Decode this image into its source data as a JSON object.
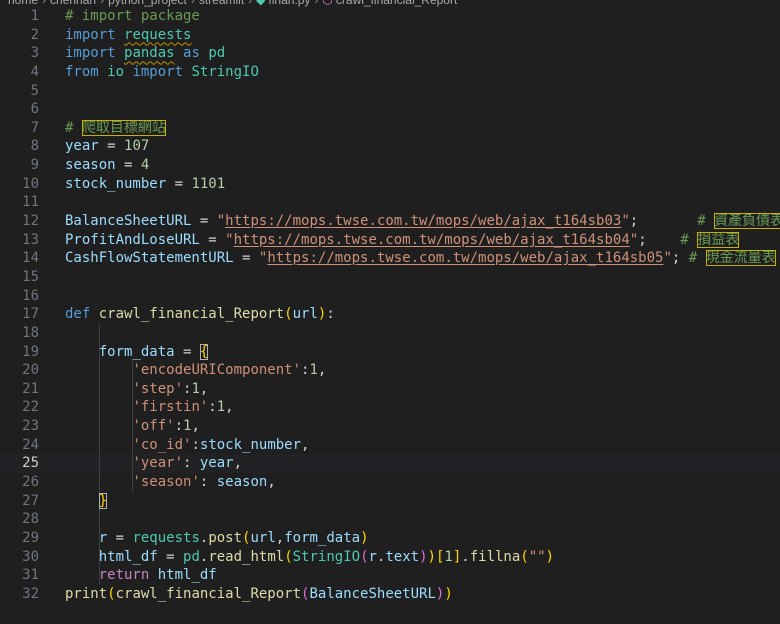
{
  "breadcrumb": {
    "segments": [
      "home",
      "chenhan",
      "python_project",
      "streamlit",
      "finan.py",
      "crawl_financial_Report"
    ]
  },
  "editor": {
    "active_line": 25,
    "lines": [
      {
        "n": 1,
        "tokens": [
          [
            "cmt",
            "# import package"
          ]
        ]
      },
      {
        "n": 2,
        "tokens": [
          [
            "kw",
            "import"
          ],
          [
            "plain",
            " "
          ],
          [
            "cls squig",
            "requests"
          ]
        ]
      },
      {
        "n": 3,
        "tokens": [
          [
            "kw",
            "import"
          ],
          [
            "plain",
            " "
          ],
          [
            "cls squig",
            "pandas"
          ],
          [
            "plain",
            " "
          ],
          [
            "kw",
            "as"
          ],
          [
            "plain",
            " "
          ],
          [
            "cls",
            "pd"
          ]
        ]
      },
      {
        "n": 4,
        "tokens": [
          [
            "kw",
            "from"
          ],
          [
            "plain",
            " "
          ],
          [
            "cls",
            "io"
          ],
          [
            "plain",
            " "
          ],
          [
            "kw",
            "import"
          ],
          [
            "plain",
            " "
          ],
          [
            "cls",
            "StringIO"
          ]
        ]
      },
      {
        "n": 5,
        "tokens": []
      },
      {
        "n": 6,
        "tokens": []
      },
      {
        "n": 7,
        "tokens": [
          [
            "cmt",
            "# "
          ],
          [
            "cmt hl-box",
            "爬取目標網站"
          ]
        ]
      },
      {
        "n": 8,
        "tokens": [
          [
            "var",
            "year"
          ],
          [
            "plain",
            " = "
          ],
          [
            "num",
            "107"
          ]
        ]
      },
      {
        "n": 9,
        "tokens": [
          [
            "var",
            "season"
          ],
          [
            "plain",
            " = "
          ],
          [
            "num",
            "4"
          ]
        ]
      },
      {
        "n": 10,
        "tokens": [
          [
            "var",
            "stock_number"
          ],
          [
            "plain",
            " = "
          ],
          [
            "num",
            "1101"
          ]
        ]
      },
      {
        "n": 11,
        "tokens": []
      },
      {
        "n": 12,
        "tokens": [
          [
            "var",
            "BalanceSheetURL"
          ],
          [
            "plain",
            " = "
          ],
          [
            "str",
            "\""
          ],
          [
            "str url",
            "https://mops.twse.com.tw/mops/web/ajax_t164sb03"
          ],
          [
            "str",
            "\""
          ],
          [
            "plain",
            ";       "
          ],
          [
            "cmt",
            "# "
          ],
          [
            "cmt hl-box",
            "資產負債表"
          ]
        ]
      },
      {
        "n": 13,
        "tokens": [
          [
            "var",
            "ProfitAndLoseURL"
          ],
          [
            "plain",
            " = "
          ],
          [
            "str",
            "\""
          ],
          [
            "str url",
            "https://mops.twse.com.tw/mops/web/ajax_t164sb04"
          ],
          [
            "str",
            "\""
          ],
          [
            "plain",
            ";    "
          ],
          [
            "cmt",
            "# "
          ],
          [
            "cmt hl-box",
            "損益表"
          ]
        ]
      },
      {
        "n": 14,
        "tokens": [
          [
            "var",
            "CashFlowStatementURL"
          ],
          [
            "plain",
            " = "
          ],
          [
            "str",
            "\""
          ],
          [
            "str url",
            "https://mops.twse.com.tw/mops/web/ajax_t164sb05"
          ],
          [
            "str",
            "\""
          ],
          [
            "plain",
            "; "
          ],
          [
            "cmt",
            "# "
          ],
          [
            "cmt hl-box",
            "現金流量表"
          ]
        ]
      },
      {
        "n": 15,
        "tokens": []
      },
      {
        "n": 16,
        "tokens": []
      },
      {
        "n": 17,
        "tokens": [
          [
            "kw",
            "def"
          ],
          [
            "plain",
            " "
          ],
          [
            "fn",
            "crawl_financial_Report"
          ],
          [
            "br1",
            "("
          ],
          [
            "var",
            "url"
          ],
          [
            "br1",
            ")"
          ],
          [
            "plain",
            ":"
          ]
        ]
      },
      {
        "n": 18,
        "tokens": []
      },
      {
        "n": 19,
        "tokens": [
          [
            "plain",
            "    "
          ],
          [
            "var",
            "form_data"
          ],
          [
            "plain",
            " = "
          ],
          [
            "br1 brace-box",
            "{"
          ]
        ]
      },
      {
        "n": 20,
        "tokens": [
          [
            "plain",
            "        "
          ],
          [
            "str",
            "'encodeURIComponent'"
          ],
          [
            "plain",
            ":"
          ],
          [
            "num",
            "1"
          ],
          [
            "plain",
            ","
          ]
        ]
      },
      {
        "n": 21,
        "tokens": [
          [
            "plain",
            "        "
          ],
          [
            "str",
            "'step'"
          ],
          [
            "plain",
            ":"
          ],
          [
            "num",
            "1"
          ],
          [
            "plain",
            ","
          ]
        ]
      },
      {
        "n": 22,
        "tokens": [
          [
            "plain",
            "        "
          ],
          [
            "str",
            "'firstin'"
          ],
          [
            "plain",
            ":"
          ],
          [
            "num",
            "1"
          ],
          [
            "plain",
            ","
          ]
        ]
      },
      {
        "n": 23,
        "tokens": [
          [
            "plain",
            "        "
          ],
          [
            "str",
            "'off'"
          ],
          [
            "plain",
            ":"
          ],
          [
            "num",
            "1"
          ],
          [
            "plain",
            ","
          ]
        ]
      },
      {
        "n": 24,
        "tokens": [
          [
            "plain",
            "        "
          ],
          [
            "str",
            "'co_id'"
          ],
          [
            "plain",
            ":"
          ],
          [
            "var",
            "stock_number"
          ],
          [
            "plain",
            ","
          ]
        ]
      },
      {
        "n": 25,
        "tokens": [
          [
            "plain",
            "        "
          ],
          [
            "str",
            "'year'"
          ],
          [
            "plain",
            ": "
          ],
          [
            "var",
            "year"
          ],
          [
            "plain",
            ","
          ]
        ]
      },
      {
        "n": 26,
        "tokens": [
          [
            "plain",
            "        "
          ],
          [
            "str",
            "'season'"
          ],
          [
            "plain",
            ": "
          ],
          [
            "var",
            "season"
          ],
          [
            "plain",
            ","
          ]
        ]
      },
      {
        "n": 27,
        "tokens": [
          [
            "plain",
            "    "
          ],
          [
            "br1 brace-box",
            "}"
          ]
        ]
      },
      {
        "n": 28,
        "tokens": []
      },
      {
        "n": 29,
        "tokens": [
          [
            "plain",
            "    "
          ],
          [
            "var",
            "r"
          ],
          [
            "plain",
            " = "
          ],
          [
            "cls",
            "requests"
          ],
          [
            "plain",
            "."
          ],
          [
            "fn",
            "post"
          ],
          [
            "br1",
            "("
          ],
          [
            "var",
            "url"
          ],
          [
            "plain",
            ","
          ],
          [
            "var",
            "form_data"
          ],
          [
            "br1",
            ")"
          ]
        ]
      },
      {
        "n": 30,
        "tokens": [
          [
            "plain",
            "    "
          ],
          [
            "var",
            "html_df"
          ],
          [
            "plain",
            " = "
          ],
          [
            "cls",
            "pd"
          ],
          [
            "plain",
            "."
          ],
          [
            "fn",
            "read_html"
          ],
          [
            "br1",
            "("
          ],
          [
            "cls",
            "StringIO"
          ],
          [
            "br2",
            "("
          ],
          [
            "var",
            "r"
          ],
          [
            "plain",
            "."
          ],
          [
            "var",
            "text"
          ],
          [
            "br2",
            ")"
          ],
          [
            "br1",
            ")"
          ],
          [
            "br1",
            "["
          ],
          [
            "num",
            "1"
          ],
          [
            "br1",
            "]"
          ],
          [
            "plain",
            "."
          ],
          [
            "fn",
            "fillna"
          ],
          [
            "br1",
            "("
          ],
          [
            "str",
            "\"\""
          ],
          [
            "br1",
            ")"
          ]
        ]
      },
      {
        "n": 31,
        "tokens": [
          [
            "plain",
            "    "
          ],
          [
            "ctrl",
            "return"
          ],
          [
            "plain",
            " "
          ],
          [
            "var",
            "html_df"
          ]
        ]
      },
      {
        "n": 32,
        "tokens": [
          [
            "fn",
            "print"
          ],
          [
            "br1",
            "("
          ],
          [
            "fn",
            "crawl_financial_Report"
          ],
          [
            "br2",
            "("
          ],
          [
            "var",
            "BalanceSheetURL"
          ],
          [
            "br2",
            ")"
          ],
          [
            "br1",
            ")"
          ]
        ]
      }
    ]
  }
}
